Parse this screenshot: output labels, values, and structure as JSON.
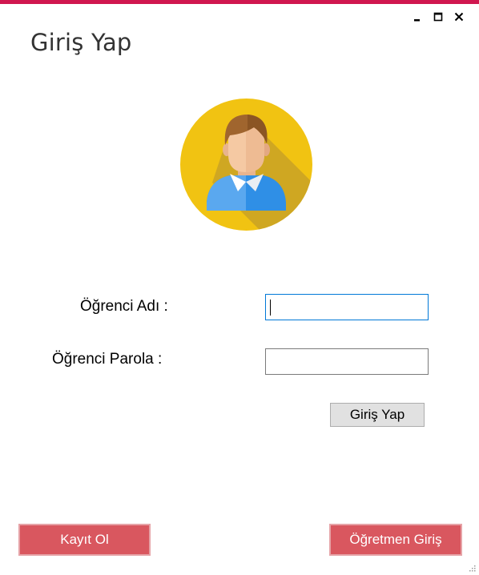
{
  "window": {
    "title": "Giriş Yap",
    "accent_color": "#d0174f",
    "controls": {
      "minimize_icon": "minimize-icon",
      "maximize_icon": "maximize-icon",
      "close_icon": "close-icon"
    }
  },
  "avatar": {
    "icon": "student-avatar-icon",
    "background_color": "#f1c312"
  },
  "form": {
    "student_name_label": "Öğrenci Adı :",
    "student_name_value": "",
    "student_password_label": "Öğrenci Parola :",
    "student_password_value": "",
    "login_button": "Giriş Yap"
  },
  "footer": {
    "register_button": "Kayıt Ol",
    "teacher_login_button": "Öğretmen Giriş",
    "button_color": "#d9575f"
  }
}
